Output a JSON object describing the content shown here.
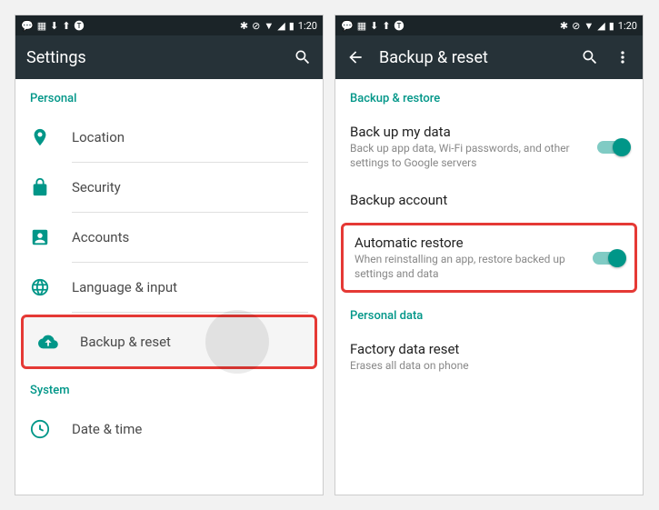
{
  "statusbar": {
    "time": "1:20"
  },
  "left": {
    "title": "Settings",
    "section_personal": "Personal",
    "items": {
      "location": "Location",
      "security": "Security",
      "accounts": "Accounts",
      "language": "Language & input",
      "backup": "Backup & reset"
    },
    "section_system": "System",
    "system_items": {
      "datetime": "Date & time"
    }
  },
  "right": {
    "title": "Backup & reset",
    "section_backup": "Backup & restore",
    "backup_data": {
      "title": "Back up my data",
      "sub": "Back up app data, Wi-Fi passwords, and other settings to Google servers"
    },
    "backup_account": {
      "title": "Backup account"
    },
    "auto_restore": {
      "title": "Automatic restore",
      "sub": "When reinstalling an app, restore backed up settings and data"
    },
    "section_personal": "Personal data",
    "factory": {
      "title": "Factory data reset",
      "sub": "Erases all data on phone"
    }
  }
}
